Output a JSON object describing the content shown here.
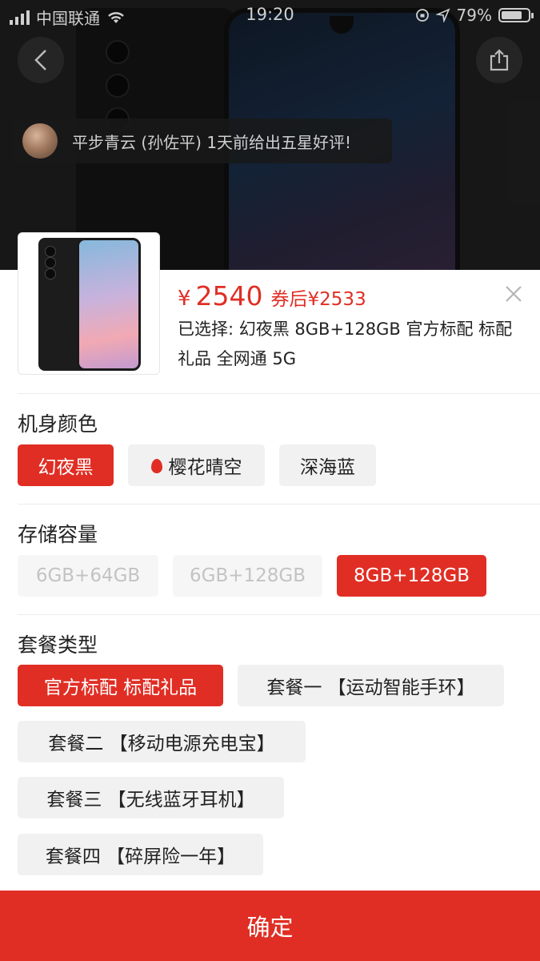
{
  "status_bar": {
    "carrier": "中国联通",
    "time": "19:20",
    "battery": "79%",
    "battery_level": 0.79
  },
  "review_banner": {
    "text": "平步青云 (孙佐平) 1天前给出五星好评!"
  },
  "product": {
    "currency": "¥",
    "price": "2540",
    "coupon_price": "券后¥2533",
    "selected": "已选择: 幻夜黑 8GB+128GB 官方标配 标配礼品 全网通 5G"
  },
  "sections": {
    "color": {
      "title": "机身颜色",
      "options": [
        "幻夜黑",
        "樱花晴空",
        "深海蓝"
      ],
      "selected": "幻夜黑"
    },
    "storage": {
      "title": "存储容量",
      "options": [
        "6GB+64GB",
        "6GB+128GB",
        "8GB+128GB"
      ],
      "selected": "8GB+128GB"
    },
    "package": {
      "title": "套餐类型",
      "options": [
        "官方标配 标配礼品",
        "套餐一 【运动智能手环】",
        "套餐二 【移动电源充电宝】",
        "套餐三 【无线蓝牙耳机】",
        "套餐四 【碎屏险一年】"
      ],
      "selected": "官方标配 标配礼品"
    }
  },
  "confirm_label": "确定",
  "colors": {
    "accent": "#e02e24",
    "chip_bg": "#f1f1f1",
    "chip_disabled_text": "#c3c3c3"
  }
}
